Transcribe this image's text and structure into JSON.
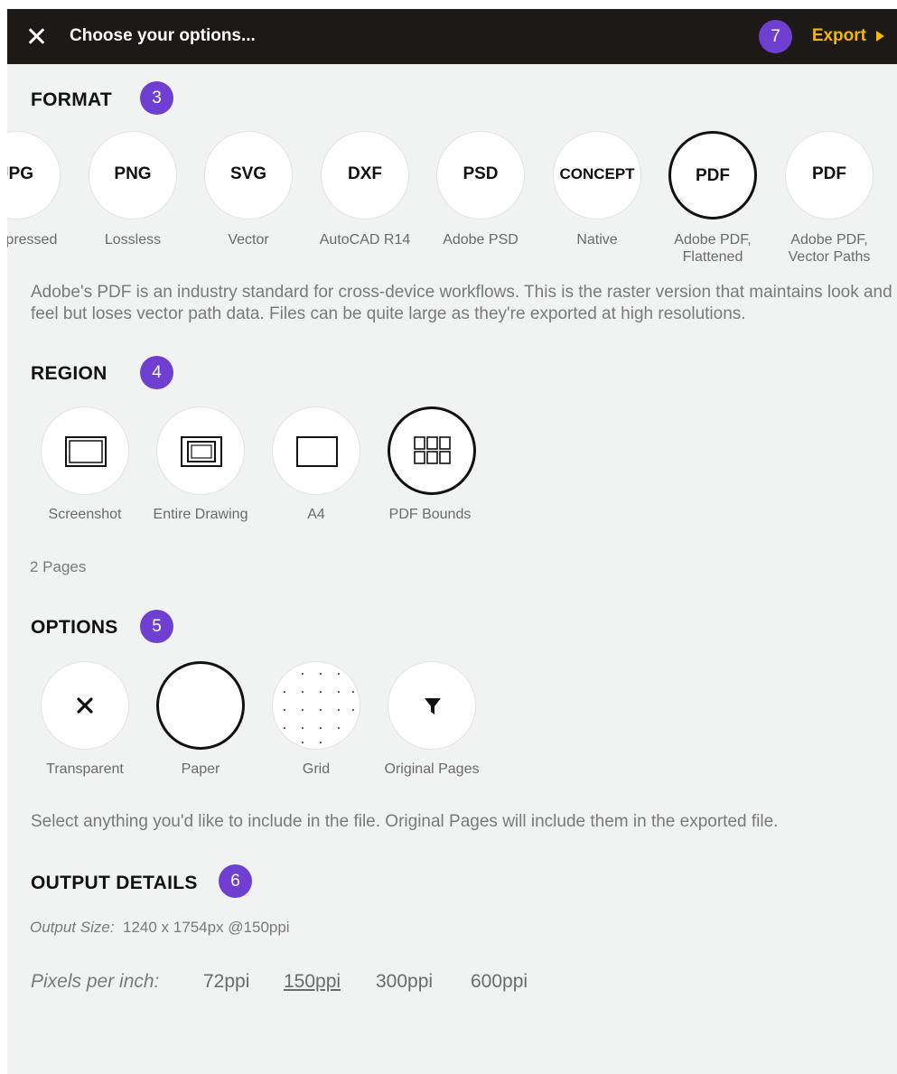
{
  "header": {
    "title": "Choose your options...",
    "badge": "7",
    "export_label": "Export"
  },
  "format": {
    "title": "FORMAT",
    "badge": "3",
    "items": [
      {
        "name": "JPG",
        "label": "Compressed"
      },
      {
        "name": "PNG",
        "label": "Lossless"
      },
      {
        "name": "SVG",
        "label": "Vector"
      },
      {
        "name": "DXF",
        "label": "AutoCAD R14"
      },
      {
        "name": "PSD",
        "label": "Adobe PSD"
      },
      {
        "name": "CONCEPT",
        "label": "Native"
      },
      {
        "name": "PDF",
        "label": "Adobe PDF,\nFlattened",
        "selected": true
      },
      {
        "name": "PDF",
        "label": "Adobe PDF,\nVector Paths"
      }
    ],
    "description": "Adobe's PDF is an industry standard for cross-device workflows. This is the raster version that maintains look and feel but loses vector path data. Files can be quite large as they're exported at high resolutions."
  },
  "region": {
    "title": "REGION",
    "badge": "4",
    "items": [
      {
        "label": "Screenshot",
        "icon": "screenshot-icon"
      },
      {
        "label": "Entire Drawing",
        "icon": "entire-drawing-icon"
      },
      {
        "label": "A4",
        "icon": "a4-page-icon"
      },
      {
        "label": "PDF Bounds",
        "icon": "pdf-bounds-grid-icon",
        "selected": true
      }
    ],
    "pages": "2 Pages"
  },
  "options": {
    "title": "OPTIONS",
    "badge": "5",
    "items": [
      {
        "label": "Transparent",
        "icon": "close-x-icon"
      },
      {
        "label": "Paper",
        "icon": "paper-icon",
        "selected": true
      },
      {
        "label": "Grid",
        "icon": "dot-grid-icon"
      },
      {
        "label": "Original Pages",
        "icon": "filter-funnel-icon"
      }
    ],
    "description": "Select anything you'd like to include in the file. Original Pages will include them in the exported file."
  },
  "output": {
    "title": "OUTPUT DETAILS",
    "badge": "6",
    "size_label": "Output Size:",
    "size_value": "1240 x 1754px @150ppi",
    "ppi_label": "Pixels per inch:",
    "ppi_options": [
      "72ppi",
      "150ppi",
      "300ppi",
      "600ppi"
    ],
    "ppi_selected": "150ppi"
  },
  "colors": {
    "badge": "#6e3fd1",
    "export": "#f5b800",
    "header_bg": "#1c1917",
    "panel_bg": "#f1f2f2"
  }
}
